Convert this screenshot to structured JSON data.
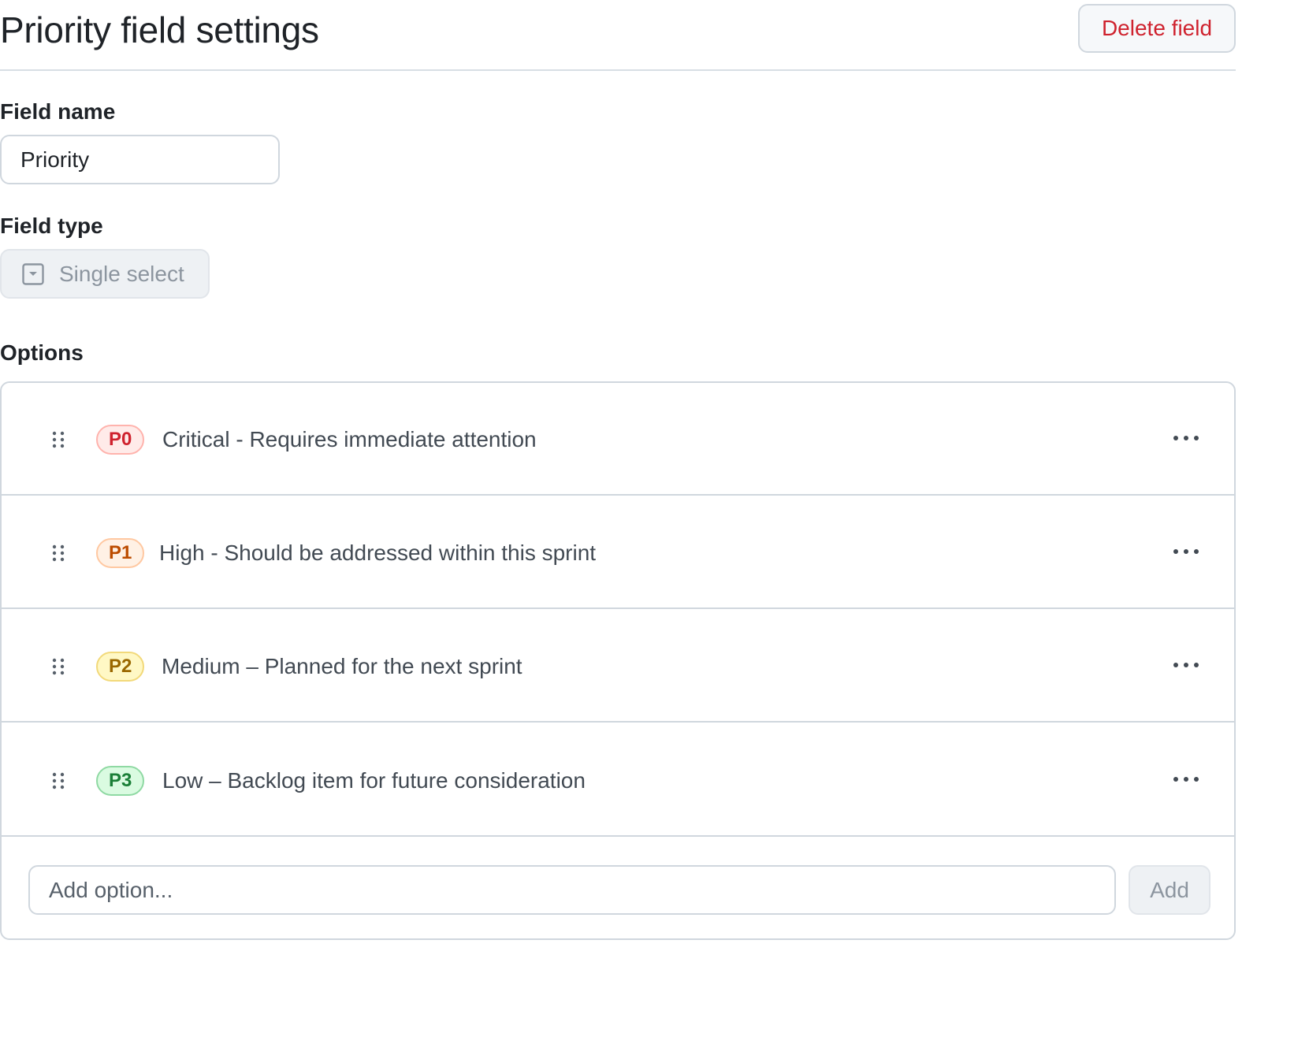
{
  "header": {
    "title": "Priority field settings",
    "delete_label": "Delete field",
    "delete_color": "#cf222e"
  },
  "field_name": {
    "label": "Field name",
    "value": "Priority"
  },
  "field_type": {
    "label": "Field type",
    "value": "Single select",
    "icon": "single-select-icon",
    "disabled": true
  },
  "options": {
    "label": "Options",
    "items": [
      {
        "badge": "P0",
        "label": "Critical - Requires immediate attention",
        "badge_text_color": "#cf222e",
        "badge_bg": "#ffebe9",
        "badge_border": "#ffb3ad",
        "menu_icon": "kebab-horizontal-icon",
        "drag_icon": "grabber-icon"
      },
      {
        "badge": "P1",
        "label": "High - Should be addressed within this sprint",
        "badge_text_color": "#bc4c00",
        "badge_bg": "#fff1e5",
        "badge_border": "#ffc8a1",
        "menu_icon": "kebab-horizontal-icon",
        "drag_icon": "grabber-icon"
      },
      {
        "badge": "P2",
        "label": "Medium – Planned for the next sprint",
        "badge_text_color": "#9a6700",
        "badge_bg": "#fff8c5",
        "badge_border": "#f2d97a",
        "menu_icon": "kebab-horizontal-icon",
        "drag_icon": "grabber-icon"
      },
      {
        "badge": "P3",
        "label": "Low – Backlog item for future consideration",
        "badge_text_color": "#1a7f37",
        "badge_bg": "#dafbe1",
        "badge_border": "#8fd9a3",
        "menu_icon": "kebab-horizontal-icon",
        "drag_icon": "grabber-icon"
      }
    ],
    "add_placeholder": "Add option...",
    "add_label": "Add"
  }
}
